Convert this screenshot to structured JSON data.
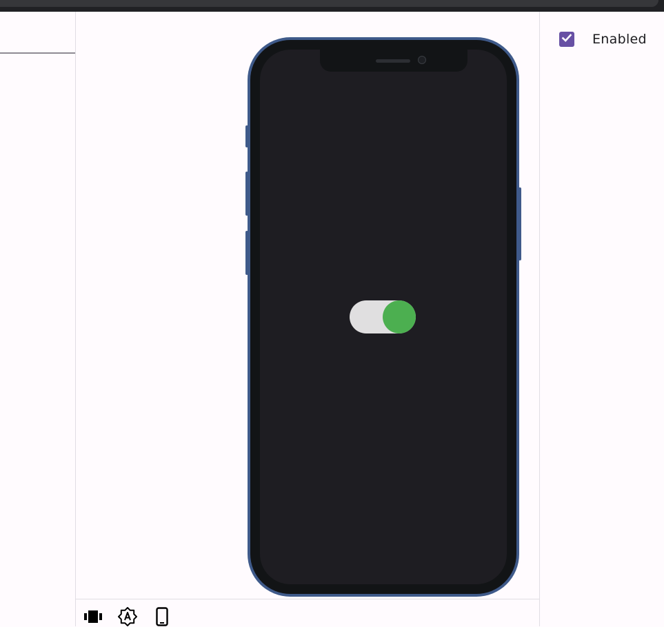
{
  "knobs": {
    "enabled_label": "Enabled",
    "enabled_checked": true
  },
  "preview": {
    "switch_on": true,
    "switch_thumb_color": "#4caf50",
    "switch_track_color": "#e0dfe0",
    "device_frame_color": "#3f5a8a",
    "screen_color": "#1e1d22"
  },
  "toolbar": {
    "items": [
      {
        "icon": "view-carousel-icon"
      },
      {
        "icon": "brightness-auto-icon"
      },
      {
        "icon": "phone-device-icon"
      }
    ]
  },
  "colors": {
    "accent": "#6750a4",
    "background": "#fffbfe"
  }
}
